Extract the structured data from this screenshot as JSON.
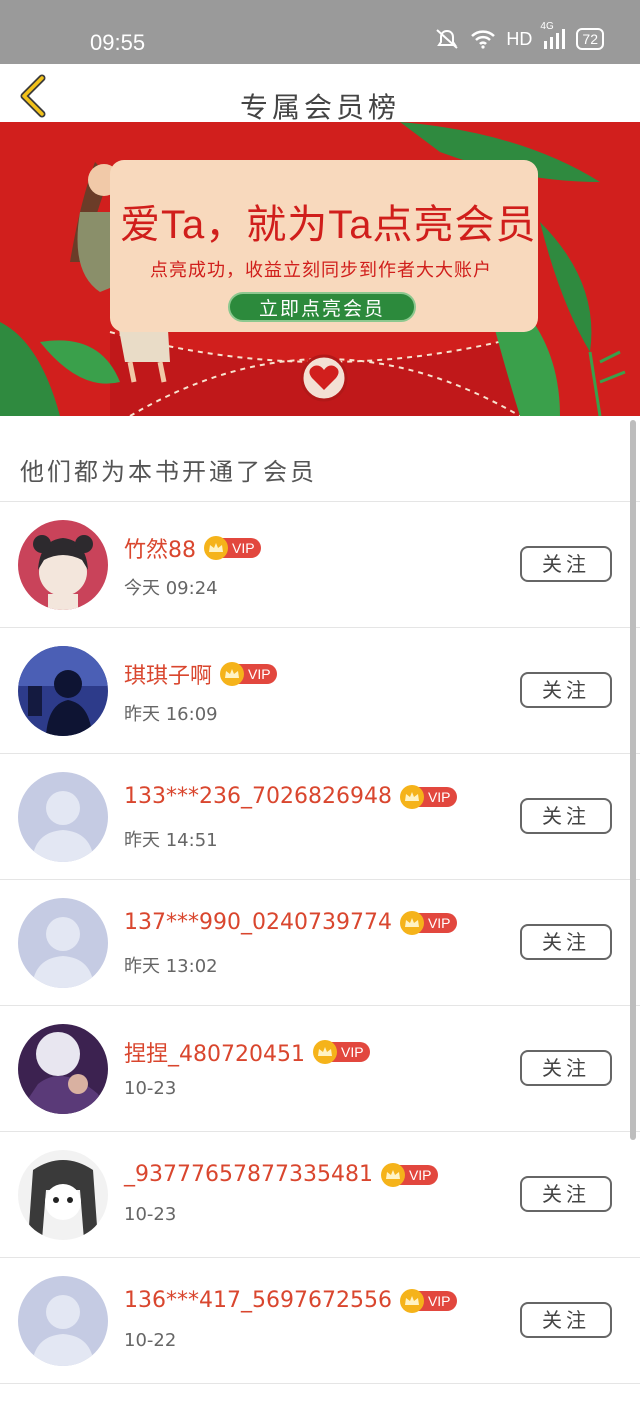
{
  "status_bar": {
    "time": "09:55",
    "network": "HD",
    "signal_label": "4G",
    "battery": "72"
  },
  "nav": {
    "title": "专属会员榜"
  },
  "banner": {
    "headline": "爱Ta，就为Ta点亮会员",
    "subtitle": "点亮成功，收益立刻同步到作者大大账户",
    "button_label": "立即点亮会员"
  },
  "section": {
    "title": "他们都为本书开通了会员"
  },
  "vip_label": "VIP",
  "follow_label": "关注",
  "members": [
    {
      "name": "竹然88",
      "time": "今天 09:24",
      "avatar": "anime-girl-avatar"
    },
    {
      "name": "琪琪子啊",
      "time": "昨天 16:09",
      "avatar": "silhouette-photo-avatar"
    },
    {
      "name": "133***236_7026826948",
      "time": "昨天 14:51",
      "avatar": "default-avatar"
    },
    {
      "name": "137***990_0240739774",
      "time": "昨天 13:02",
      "avatar": "default-avatar"
    },
    {
      "name": "捏捏_480720451",
      "time": "10-23",
      "avatar": "photo-avatar"
    },
    {
      "name": "_93777657877335481",
      "time": "10-23",
      "avatar": "manga-girl-avatar"
    },
    {
      "name": "136***417_5697672556",
      "time": "10-22",
      "avatar": "default-avatar"
    }
  ],
  "colors": {
    "banner_red": "#d11f1d",
    "name_red": "#d9462e",
    "vip_red": "#e2473e",
    "crown_gold": "#f5b31a",
    "button_green": "#2c8a3c"
  }
}
